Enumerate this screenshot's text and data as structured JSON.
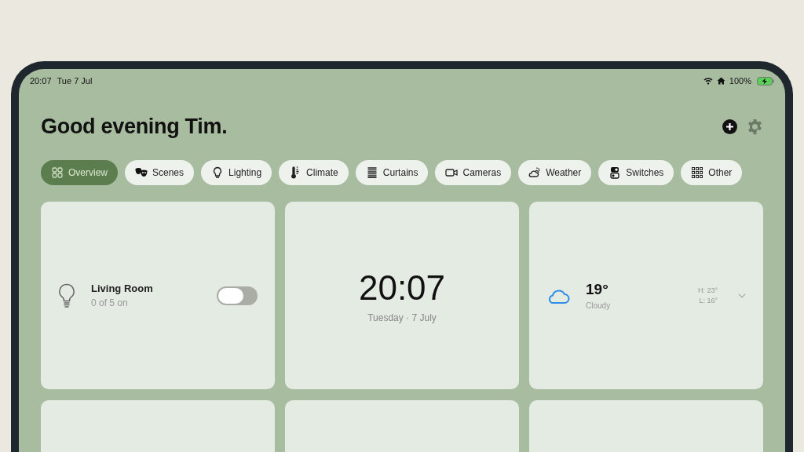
{
  "status_bar": {
    "time": "20:07",
    "date": "Tue 7 Jul",
    "battery": "100%",
    "charging": true
  },
  "greeting": "Good evening Tim.",
  "tabs": [
    {
      "label": "Overview",
      "selected": true
    },
    {
      "label": "Scenes",
      "selected": false
    },
    {
      "label": "Lighting",
      "selected": false
    },
    {
      "label": "Climate",
      "selected": false
    },
    {
      "label": "Curtains",
      "selected": false
    },
    {
      "label": "Cameras",
      "selected": false
    },
    {
      "label": "Weather",
      "selected": false
    },
    {
      "label": "Switches",
      "selected": false
    },
    {
      "label": "Other",
      "selected": false
    }
  ],
  "cards": [
    {
      "kind": "room",
      "name": "Living Room",
      "status": "0 of 5 on",
      "on": false
    },
    {
      "kind": "clock",
      "time": "20:07",
      "date": "Tuesday · 7 July"
    },
    {
      "kind": "weather",
      "temperature": "19°",
      "condition": "Cloudy",
      "high": "H: 23°",
      "low": "L: 16°"
    },
    {
      "kind": "blank"
    },
    {
      "kind": "blank"
    },
    {
      "kind": "blank"
    }
  ]
}
